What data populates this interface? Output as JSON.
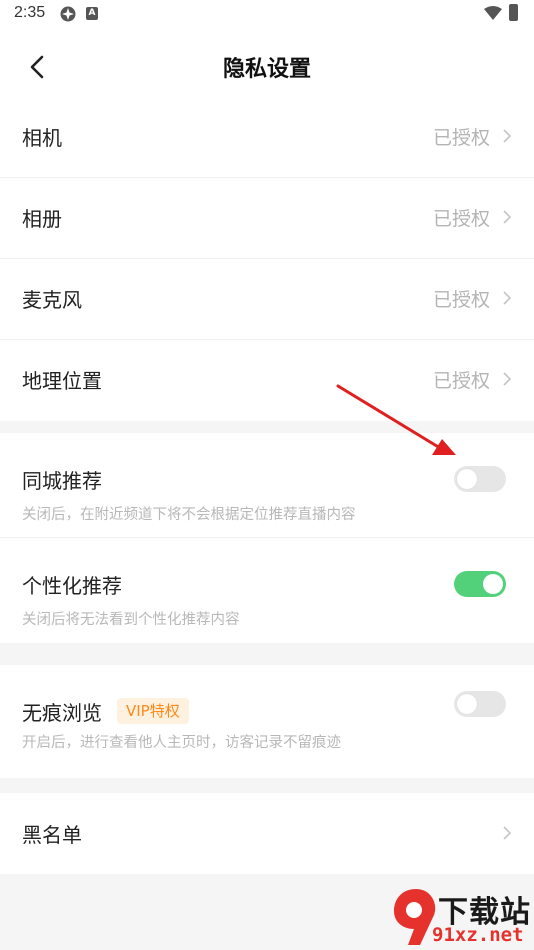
{
  "status_bar": {
    "time": "2:35",
    "notif_icon_letter": "A"
  },
  "header": {
    "title": "隐私设置"
  },
  "permissions": [
    {
      "label": "相机",
      "value": "已授权"
    },
    {
      "label": "相册",
      "value": "已授权"
    },
    {
      "label": "麦克风",
      "value": "已授权"
    },
    {
      "label": "地理位置",
      "value": "已授权"
    }
  ],
  "recommend": {
    "local": {
      "label": "同城推荐",
      "desc": "关闭后，在附近频道下将不会根据定位推荐直播内容",
      "enabled": false
    },
    "personal": {
      "label": "个性化推荐",
      "desc": "关闭后将无法看到个性化推荐内容",
      "enabled": true
    }
  },
  "incognito": {
    "label": "无痕浏览",
    "badge": "VIP特权",
    "desc": "开启后，进行查看他人主页时，访客记录不留痕迹",
    "enabled": false
  },
  "blacklist": {
    "label": "黑名单"
  },
  "watermark": {
    "title": "下载站",
    "url": "91xz.net"
  },
  "colors": {
    "toggle_on": "#53d17a",
    "toggle_off": "#e6e6e6",
    "vip_text": "#ff8a1a",
    "vip_bg": "#fff1df",
    "arrow": "#e02020"
  }
}
